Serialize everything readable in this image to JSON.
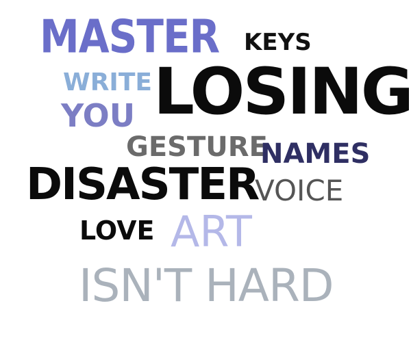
{
  "words": {
    "master": {
      "text": "MASTER",
      "color": "#6a6ec9"
    },
    "keys": {
      "text": "KEYS",
      "color": "#111111"
    },
    "write": {
      "text": "WRITE",
      "color": "#8aaed8"
    },
    "losing": {
      "text": "LOSING",
      "color": "#0b0b0b"
    },
    "you": {
      "text": "YOU",
      "color": "#7c7ec4"
    },
    "gesture": {
      "text": "GESTURE",
      "color": "#6b6b6b"
    },
    "names": {
      "text": "NAMES",
      "color": "#2f2f63"
    },
    "disaster": {
      "text": "DISASTER",
      "color": "#0b0b0b"
    },
    "voice": {
      "text": "VOICE",
      "color": "#555555"
    },
    "love": {
      "text": "LOVE",
      "color": "#0b0b0b"
    },
    "art": {
      "text": "ART",
      "color": "#b4b8e8"
    },
    "isnt_hard": {
      "text": "ISN'T HARD",
      "color": "#aab2bb"
    }
  }
}
